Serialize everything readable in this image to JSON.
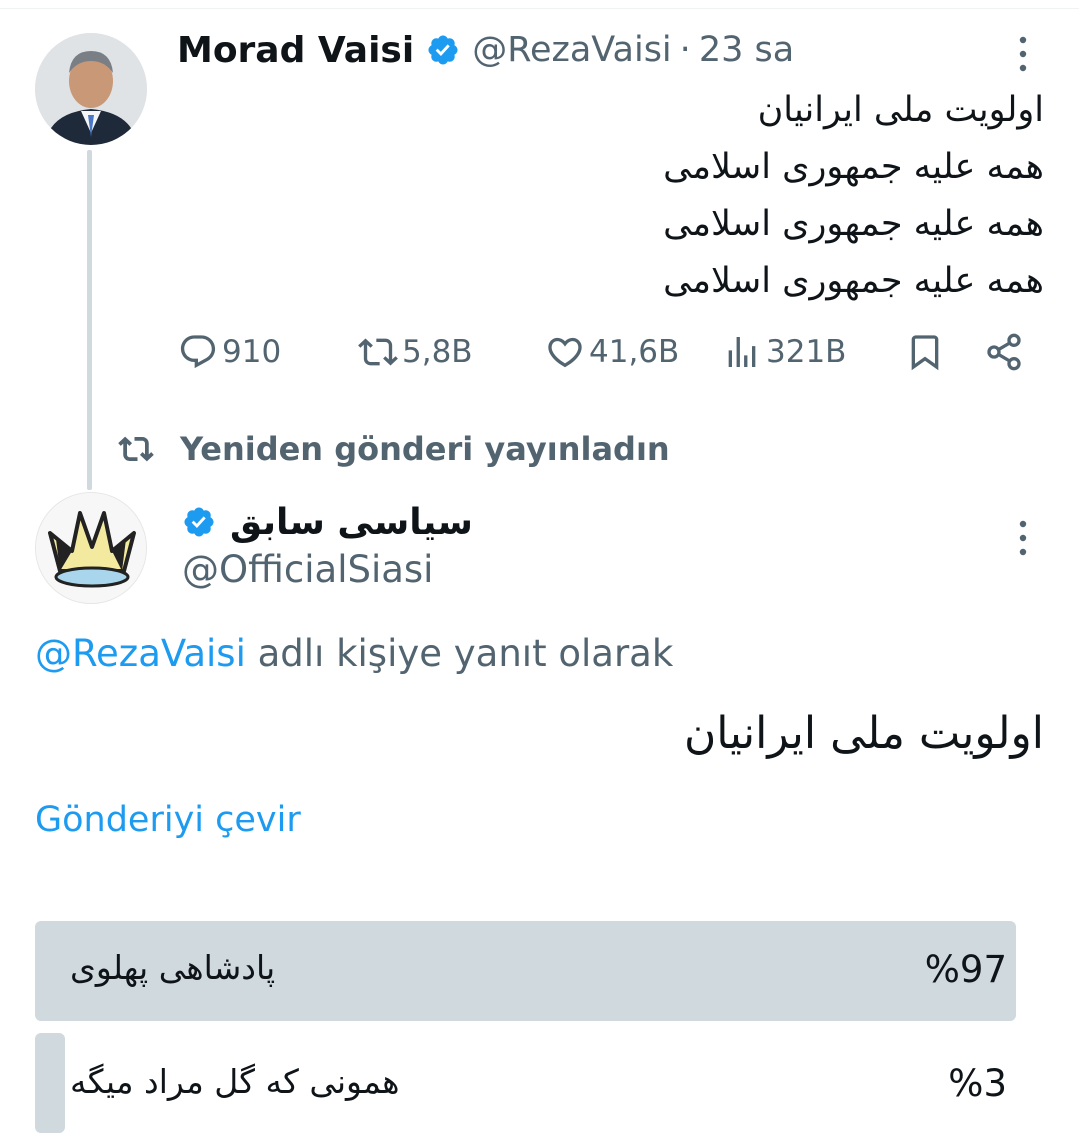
{
  "tweet1": {
    "author_name": "Morad Vaisi",
    "handle": "@RezaVaisi",
    "separator": "·",
    "time": "23 sa",
    "lines": [
      "اولویت ملی ایرانیان",
      "همه علیه جمهوری اسلامی",
      "همه علیه جمهوری اسلامی",
      "همه علیه جمهوری اسلامی"
    ],
    "stats": {
      "replies": "910",
      "reposts": "5,8B",
      "likes": "41,6B",
      "views": "321B"
    }
  },
  "repost_context": "Yeniden gönderi yayınladın",
  "tweet2": {
    "author_name": "سیاسی سابق",
    "handle": "@OfficialSiasi",
    "reply_mention": "@RezaVaisi",
    "reply_suffix": " adlı kişiye yanıt olarak",
    "text": "اولویت ملی ایرانیان",
    "translate_label": "Gönderiyi çevir",
    "poll": [
      {
        "label": "پادشاهی  پهلوی",
        "percent_text": "%97",
        "percent": 97
      },
      {
        "label": "همونی که گل مراد میگه",
        "percent_text": "%3",
        "percent": 3
      }
    ]
  },
  "colors": {
    "accent": "#1d9bf0",
    "muted": "#536471",
    "poll_bar": "#cfd9de",
    "thread_line": "#cfd9de"
  },
  "icons": [
    "verified-badge-icon",
    "more-vertical-icon",
    "reply-icon",
    "repost-icon",
    "like-icon",
    "views-icon",
    "bookmark-icon",
    "share-icon"
  ]
}
